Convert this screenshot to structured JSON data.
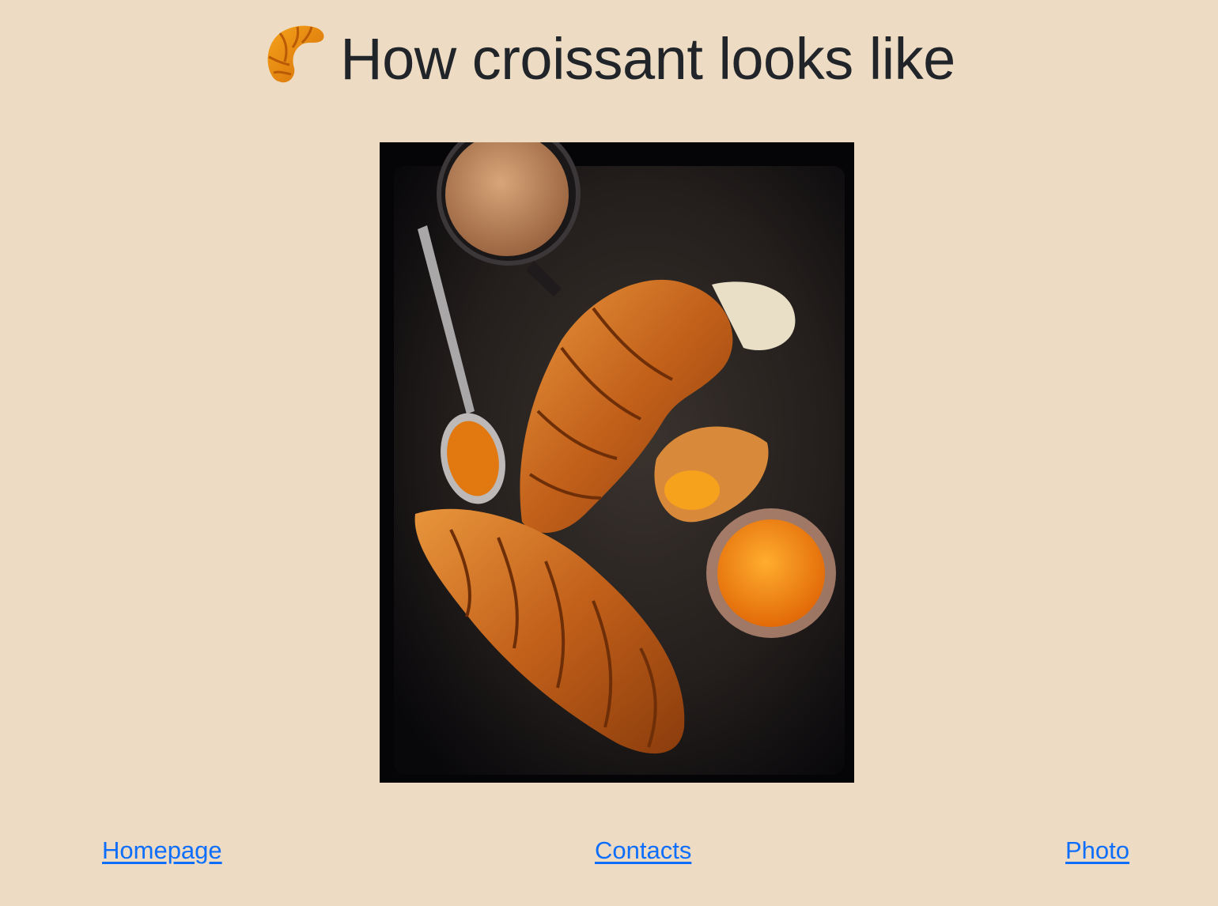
{
  "header": {
    "title": "How croissant looks like",
    "icon": "croissant-emoji-icon"
  },
  "photo": {
    "alt": "Croissants with coffee and apricot jam on a dark baking tray",
    "subject": "croissant-photo"
  },
  "footer": {
    "links": [
      {
        "label": "Homepage"
      },
      {
        "label": "Contacts"
      },
      {
        "label": "Photo"
      }
    ]
  },
  "colors": {
    "background": "#eddcc3",
    "text": "#212529",
    "link": "#0d6efd"
  }
}
